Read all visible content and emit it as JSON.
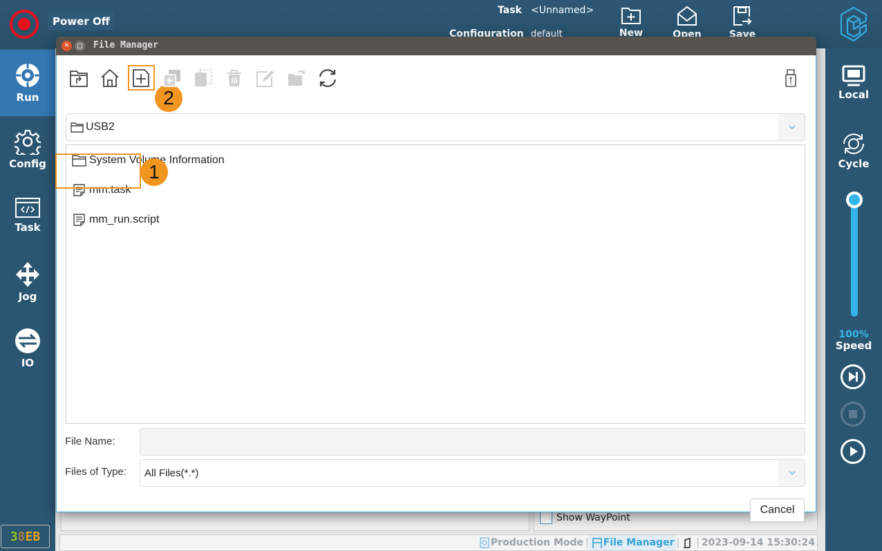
{
  "topbar": {
    "power_label": "Power Off",
    "task_label": "Task",
    "task_value": "<Unnamed>",
    "configuration_label": "Configuration",
    "configuration_value": "default",
    "actions": [
      {
        "label": "New",
        "icon": "folder-plus-icon"
      },
      {
        "label": "Open",
        "icon": "open-envelope-icon"
      },
      {
        "label": "Save",
        "icon": "save-icon"
      }
    ]
  },
  "sidebar": {
    "items": [
      {
        "label": "Run",
        "icon": "run-icon",
        "active": true
      },
      {
        "label": "Config",
        "icon": "gear-icon"
      },
      {
        "label": "Task",
        "icon": "code-window-icon"
      },
      {
        "label": "Jog",
        "icon": "move-arrows-icon"
      },
      {
        "label": "IO",
        "icon": "io-swap-icon"
      }
    ],
    "device_badge": {
      "text": "38EB",
      "colors": [
        "#8fc31f",
        "#a87f3c",
        "#e0a21e",
        "#e0a21e"
      ]
    }
  },
  "rightbar": {
    "local_label": "Local",
    "cycle_label": "Cycle",
    "speed_value": "100%",
    "speed_fraction": 1.0,
    "speed_label": "Speed"
  },
  "dialog": {
    "title": "File Manager",
    "toolbar": [
      {
        "name": "parent-folder-icon",
        "enabled": true
      },
      {
        "name": "home-icon",
        "enabled": true
      },
      {
        "name": "new-file-icon",
        "enabled": true,
        "highlighted": true
      },
      {
        "name": "copy-icon",
        "enabled": false
      },
      {
        "name": "paste-icon",
        "enabled": false
      },
      {
        "name": "delete-icon",
        "enabled": false
      },
      {
        "name": "rename-icon",
        "enabled": false
      },
      {
        "name": "open-folder-icon",
        "enabled": false
      },
      {
        "name": "refresh-icon",
        "enabled": true
      }
    ],
    "current_path": "USB2",
    "files": [
      {
        "name": "System Volume Information",
        "type": "folder"
      },
      {
        "name": "mm.task",
        "type": "file",
        "highlighted": true
      },
      {
        "name": "mm_run.script",
        "type": "file"
      }
    ],
    "file_name_label": "File Name:",
    "file_name_value": "",
    "files_of_type_label": "Files of Type:",
    "files_of_type_value": "All Files(*.*)",
    "cancel_label": "Cancel",
    "callouts": [
      "1",
      "2"
    ]
  },
  "background": {
    "show_waypoint_label": "Show WayPoint"
  },
  "statusbar": {
    "production_mode": "Production Mode",
    "file_manager": "File Manager",
    "datetime": "2023-09-14 15:30:24"
  },
  "colors": {
    "accent": "#35b6ea",
    "highlight": "#f0951f",
    "power": "#e8101a",
    "sidebar_bg": "#2b5671",
    "sidebar_active": "#3378b3"
  }
}
